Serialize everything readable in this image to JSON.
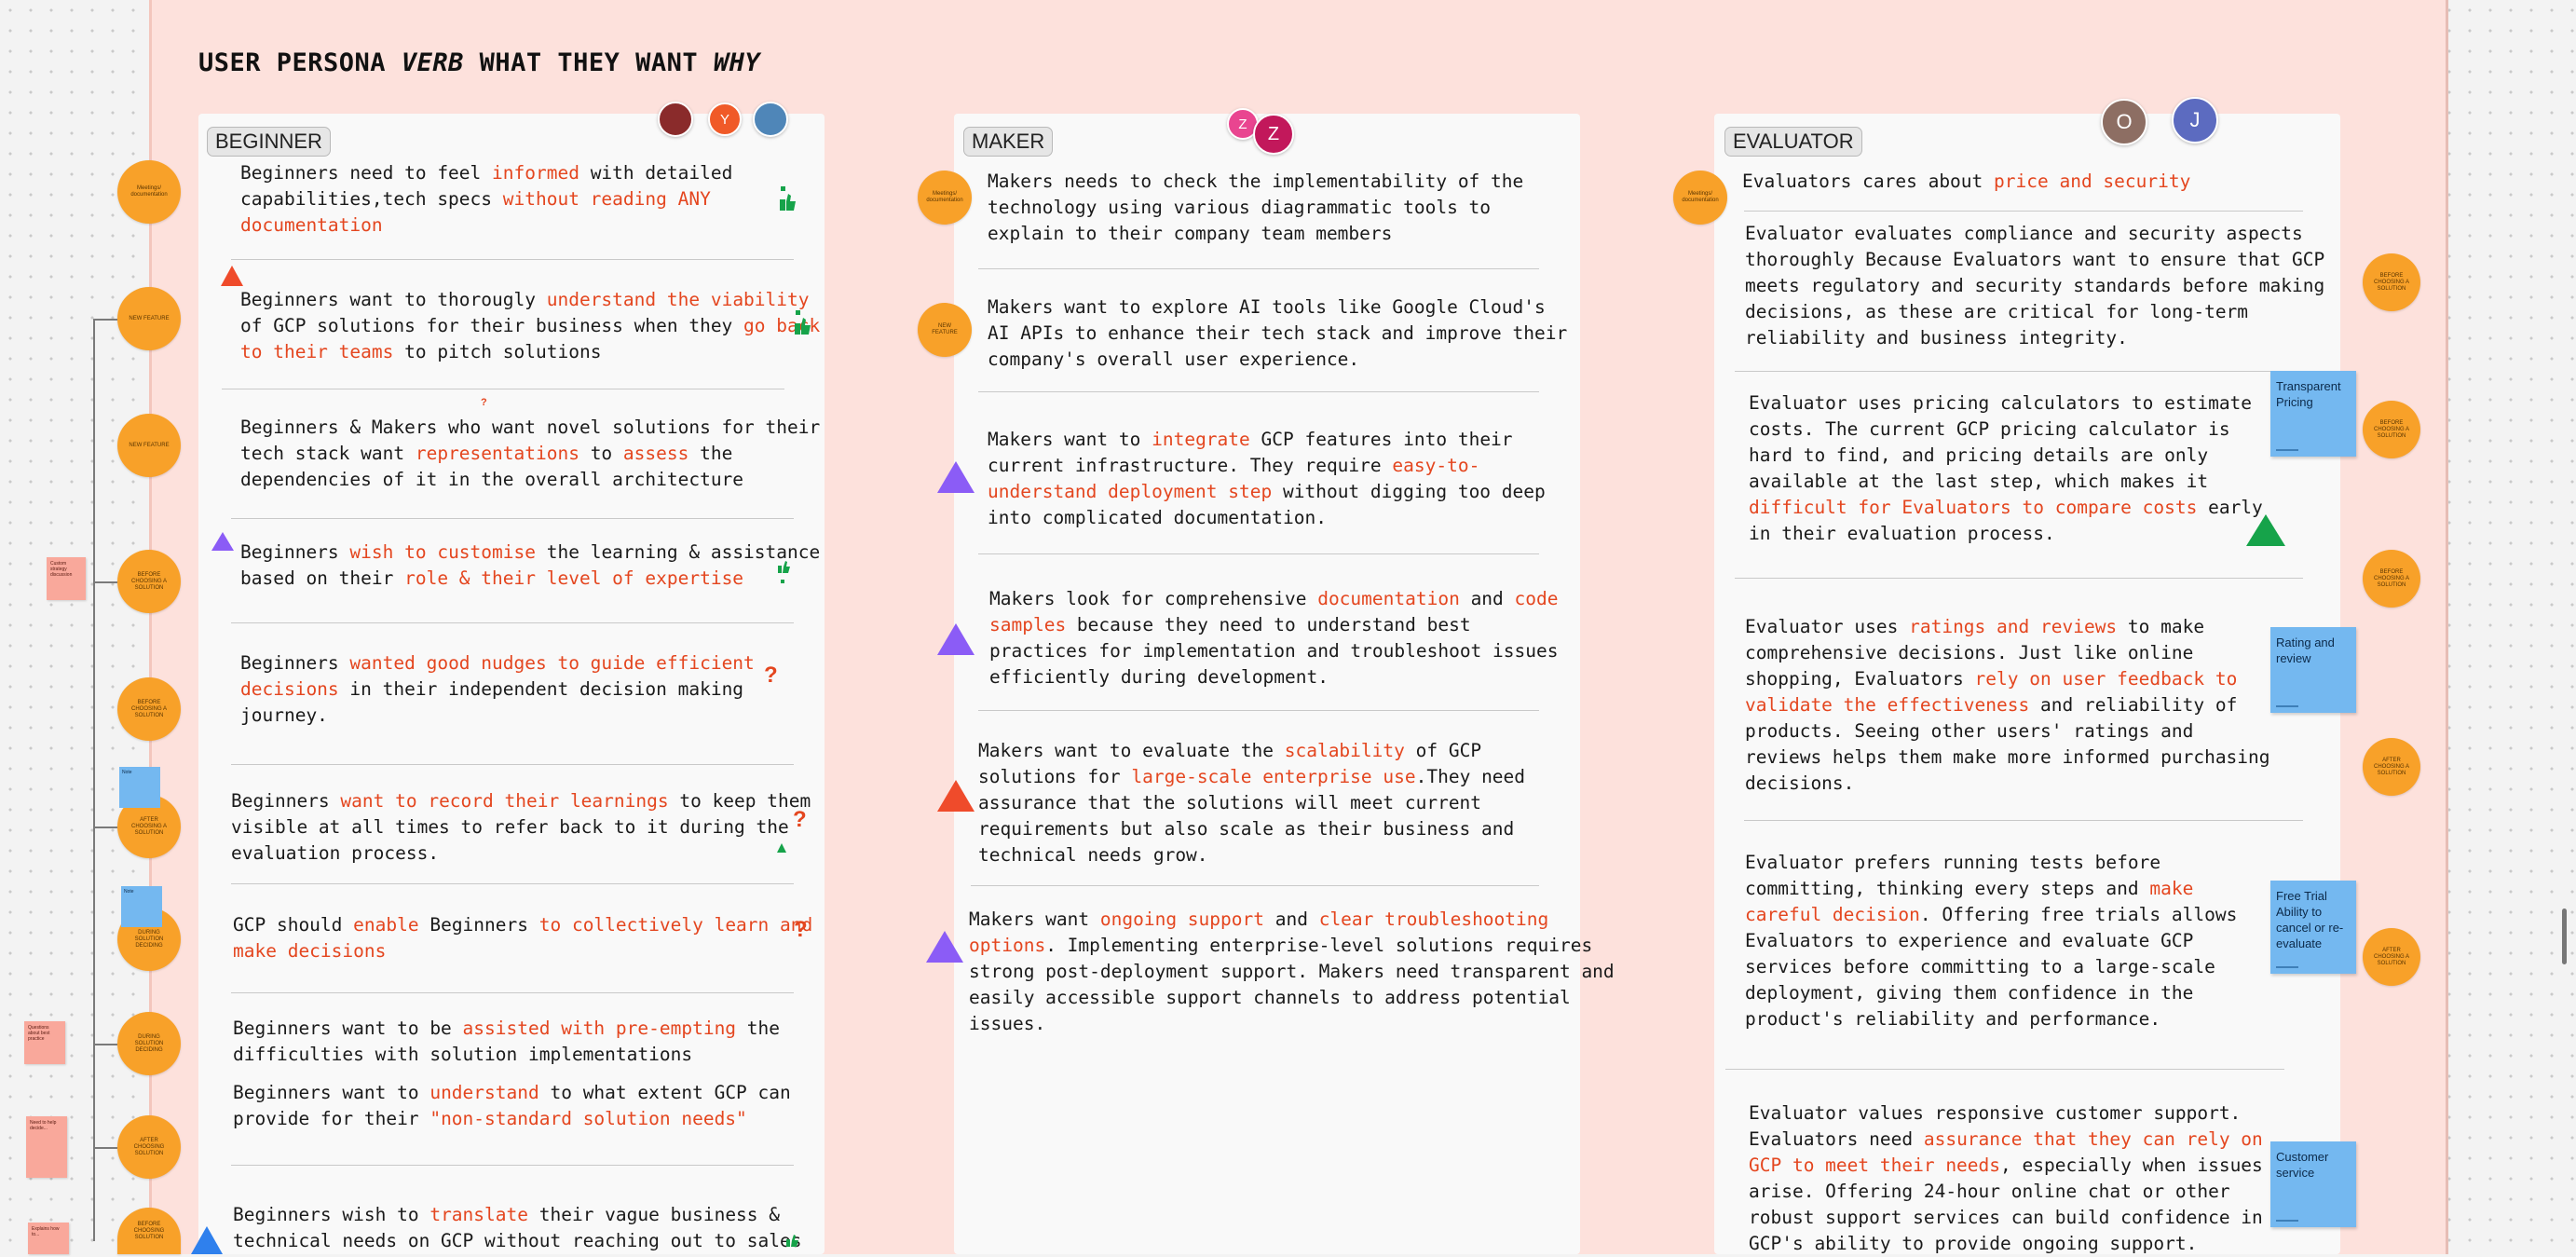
{
  "header": {
    "title_a": "USER PERSONA ",
    "title_b": "VERB",
    "title_c": " WHAT THEY WANT ",
    "title_d": "WHY"
  },
  "columns": {
    "beginner": {
      "tag": "BEGINNER"
    },
    "maker": {
      "tag": "MAKER"
    },
    "evaluator": {
      "tag": "EVALUATOR"
    }
  },
  "avatars": {
    "beginner_y": "Y",
    "maker_z1": "Z",
    "maker_z2": "Z",
    "evaluator_o": "O",
    "evaluator_j": "J"
  },
  "colors": {
    "accent_red": "#e4461f",
    "orange": "#f8a129",
    "sticky_blue": "#74b8f0",
    "sticky_pink": "#f9a89b",
    "triangle_purple": "#8b5cf6",
    "triangle_red": "#ef4b2b",
    "triangle_green": "#16a34a",
    "triangle_blue": "#2f80ed"
  },
  "beginner_stmts": [
    {
      "p1": "Beginners need to feel ",
      "h1": "informed",
      "p2": " with detailed\ncapabilities,tech specs ",
      "h2": "without reading ANY\ndocumentation",
      "p3": ""
    },
    {
      "p1": "Beginners want to thorougly ",
      "h1": "understand the viability",
      "p2": "\nof GCP solutions for their business when they ",
      "h2": "go back\nto their teams",
      "p3": " to pitch solutions"
    },
    {
      "p1": "Beginners & Makers who want novel solutions for their\ntech stack want ",
      "h1": "representations",
      "p2": " to ",
      "h2": "assess",
      "p3": " the\ndependencies of it in the overall architecture"
    },
    {
      "p1": "Beginners ",
      "h1": "wish to customise",
      "p2": " the learning & assistance\nbased on their ",
      "h2": "role & their level of expertise",
      "p3": ""
    },
    {
      "p1": "Beginners ",
      "h1": "wanted good nudges to guide efficient\ndecisions",
      "p2": " in their independent decision making\njourney.",
      "h2": "",
      "p3": ""
    },
    {
      "p1": "Beginners ",
      "h1": "want to record their learnings",
      "p2": " to keep them\nvisible at all times to refer back to it during the\nevaluation process.",
      "h2": "",
      "p3": ""
    },
    {
      "p1": "GCP should ",
      "h1": "enable",
      "p2": " Beginners ",
      "h2": "to collectively learn and\nmake decisions",
      "p3": ""
    },
    {
      "p1": "Beginners want to be ",
      "h1": "assisted with pre-empting",
      "p2": " the\ndifficulties with solution implementations",
      "h2": "",
      "p3": ""
    },
    {
      "p1": "Beginners want to ",
      "h1": "understand",
      "p2": " to what extent GCP can\nprovide for their ",
      "h2": "\"non-standard solution needs\"",
      "p3": ""
    },
    {
      "p1": "Beginners wish to ",
      "h1": "translate",
      "p2": " their vague business &\ntechnical needs on GCP without reaching out to sales",
      "h2": "",
      "p3": ""
    }
  ],
  "maker_stmts": [
    {
      "p1": "Makers needs to check the implementability of the\ntechnology using various diagrammatic tools to\nexplain to their company team members",
      "h1": "",
      "p2": "",
      "h2": "",
      "p3": ""
    },
    {
      "p1": "Makers want to explore AI tools like Google Cloud's\nAI APIs to enhance their tech stack and improve their\ncompany's overall user experience.",
      "h1": "",
      "p2": "",
      "h2": "",
      "p3": ""
    },
    {
      "p1": "Makers want to ",
      "h1": "integrate",
      "p2": " GCP features into their\ncurrent infrastructure. They require ",
      "h2": "easy-to-\nunderstand deployment step",
      "p3": " without digging too deep\ninto complicated documentation."
    },
    {
      "p1": "Makers look for comprehensive ",
      "h1": "documentation",
      "p2": " and ",
      "h2": "code\nsamples",
      "p3": " because they need to understand best\npractices for implementation and troubleshoot issues\nefficiently during development."
    },
    {
      "p1": "Makers want to evaluate the ",
      "h1": "scalability",
      "p2": " of GCP\nsolutions for ",
      "h2": "large-scale enterprise use",
      "p3": ".They need\nassurance that the solutions will meet current\nrequirements but also scale as their business and\ntechnical needs grow."
    },
    {
      "p1": "Makers want ",
      "h1": "ongoing support",
      "p2": " and ",
      "h2": "clear troubleshooting\noptions",
      "p3": ". Implementing enterprise-level solutions requires\nstrong post-deployment support. Makers need transparent and\neasily accessible support channels to address potential\nissues."
    }
  ],
  "evaluator_stmts": [
    {
      "p1": "Evaluators cares about ",
      "h1": "price and security",
      "p2": "",
      "h2": "",
      "p3": ""
    },
    {
      "p1": "Evaluator evaluates compliance and security aspects\nthoroughly Because Evaluators want to ensure that GCP\nmeets regulatory and security standards before making\ndecisions, as these are critical for long-term\nreliability and business integrity.",
      "h1": "",
      "p2": "",
      "h2": "",
      "p3": ""
    },
    {
      "p1": "Evaluator uses pricing calculators to estimate\ncosts. The current GCP pricing calculator is\nhard to find, and pricing details are only\navailable at the last step, which makes it\n",
      "h1": "difficult for Evaluators to compare costs",
      "p2": " early\nin their evaluation process.",
      "h2": "",
      "p3": ""
    },
    {
      "p1": "Evaluator uses ",
      "h1": "ratings and reviews",
      "p2": " to make\ncomprehensive decisions. Just like online\nshopping, Evaluators ",
      "h2": "rely on user feedback to\nvalidate the effectiveness",
      "p3": " and reliability of\nproducts. Seeing other users' ratings and\nreviews helps them make more informed purchasing\ndecisions."
    },
    {
      "p1": "Evaluator prefers running tests before\ncommitting, thinking every steps and ",
      "h1": "make\ncareful decision",
      "p2": ". Offering free trials allows\nEvaluators to experience and evaluate GCP\nservices before committing to a large-scale\ndeployment, giving them confidence in the\nproduct's reliability and performance.",
      "h2": "",
      "p3": ""
    },
    {
      "p1": "Evaluator values responsive customer support.\nEvaluators need ",
      "h1": "assurance that they can rely on\nGCP to meet their needs",
      "p2": ", especially when issues\narise. Offering 24-hour online chat or other\nrobust support services can build confidence in\nGCP's ability to provide ongoing support.",
      "h2": "",
      "p3": ""
    }
  ],
  "stickies": {
    "transparent_pricing": "Transparent Pricing",
    "rating_review": "Rating and review",
    "free_trial": "Free Trial Ability to cancel or re-evaluate",
    "customer_service": "Customer service"
  },
  "dots": {
    "b1": "Meetings/ documentation",
    "b2": "NEW FEATURE",
    "b3": "NEW FEATURE",
    "b4": "BEFORE CHOOSING A SOLUTION",
    "b5": "BEFORE CHOOSING A SOLUTION",
    "b6": "AFTER CHOOSING A SOLUTION",
    "b7": "DURING SOLUTION DECIDING",
    "b8": "DURING SOLUTION DECIDING",
    "b9": "AFTER CHOOSING SOLUTION",
    "b10": "BEFORE CHOOSING SOLUTION",
    "m1": "Meetings/ documentation",
    "m2": "NEW FEATURE",
    "e1": "Meetings/ documentation",
    "e2": "BEFORE CHOOSING A SOLUTION",
    "e3": "BEFORE CHOOSING A SOLUTION",
    "e4": "BEFORE CHOOSING A SOLUTION",
    "e5": "AFTER CHOOSING A SOLUTION",
    "e6": "AFTER CHOOSING A SOLUTION"
  },
  "left_notes": {
    "pink1": "Custom strategy discussion",
    "blue1": "Note",
    "blue2": "Note",
    "pink2": "Questions about best practice",
    "pink3": "Need to help decide...",
    "pink4": "Explains how to..."
  },
  "markers": {
    "question": "?"
  }
}
